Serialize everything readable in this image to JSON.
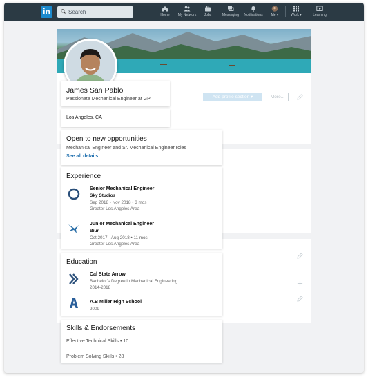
{
  "nav": {
    "logo": "in",
    "search_placeholder": "Search",
    "items": [
      {
        "label": "Home"
      },
      {
        "label": "My Network"
      },
      {
        "label": "Jobs"
      },
      {
        "label": "Messaging"
      },
      {
        "label": "Notifications"
      },
      {
        "label": "Me ▾"
      },
      {
        "label": "Work ▾"
      },
      {
        "label": "Learning"
      }
    ]
  },
  "profile": {
    "name": "James San Pablo",
    "headline": "Passionate Mechanical Engineer at GP",
    "location": "Los Angeles, CA",
    "add_section_label": "Add profile section ▾",
    "more_label": "More..."
  },
  "opportunities": {
    "title": "Open to new opportunities",
    "description": "Mechanical Engineer and Sr. Mechanical Engineer roles",
    "link": "See all details"
  },
  "experience": {
    "title": "Experience",
    "items": [
      {
        "role": "Senior Mechanical Engineer",
        "company": "Sky Studios",
        "dates": "Sep 2018 - Nov 2018 • 3 mos",
        "location": "Greater Los Angeles Area",
        "icon": "ring-icon"
      },
      {
        "role": "Junior Mechanical Engineer",
        "company": "Biur",
        "dates": "Oct 2017 - Aug 2018 • 11 mos",
        "location": "Greater Los Angeles Area",
        "icon": "bird-icon"
      }
    ]
  },
  "education": {
    "title": "Education",
    "items": [
      {
        "school": "Cal State Arrow",
        "degree": "Bachelor's Degree in Mechanical Engineering",
        "years": "2014-2018",
        "icon": "chevron-double-icon"
      },
      {
        "school": "A.B Miller High School",
        "years": "2009",
        "icon": "letter-a-icon"
      }
    ]
  },
  "skills": {
    "title": "Skills & Endorsements",
    "items": [
      {
        "label": "Effective Technical Skills • 10"
      },
      {
        "label": "Problem Solving Skills • 28"
      }
    ]
  },
  "colors": {
    "topbar": "#2b3a44",
    "brand": "#1c8acd",
    "link": "#1f6fae"
  }
}
